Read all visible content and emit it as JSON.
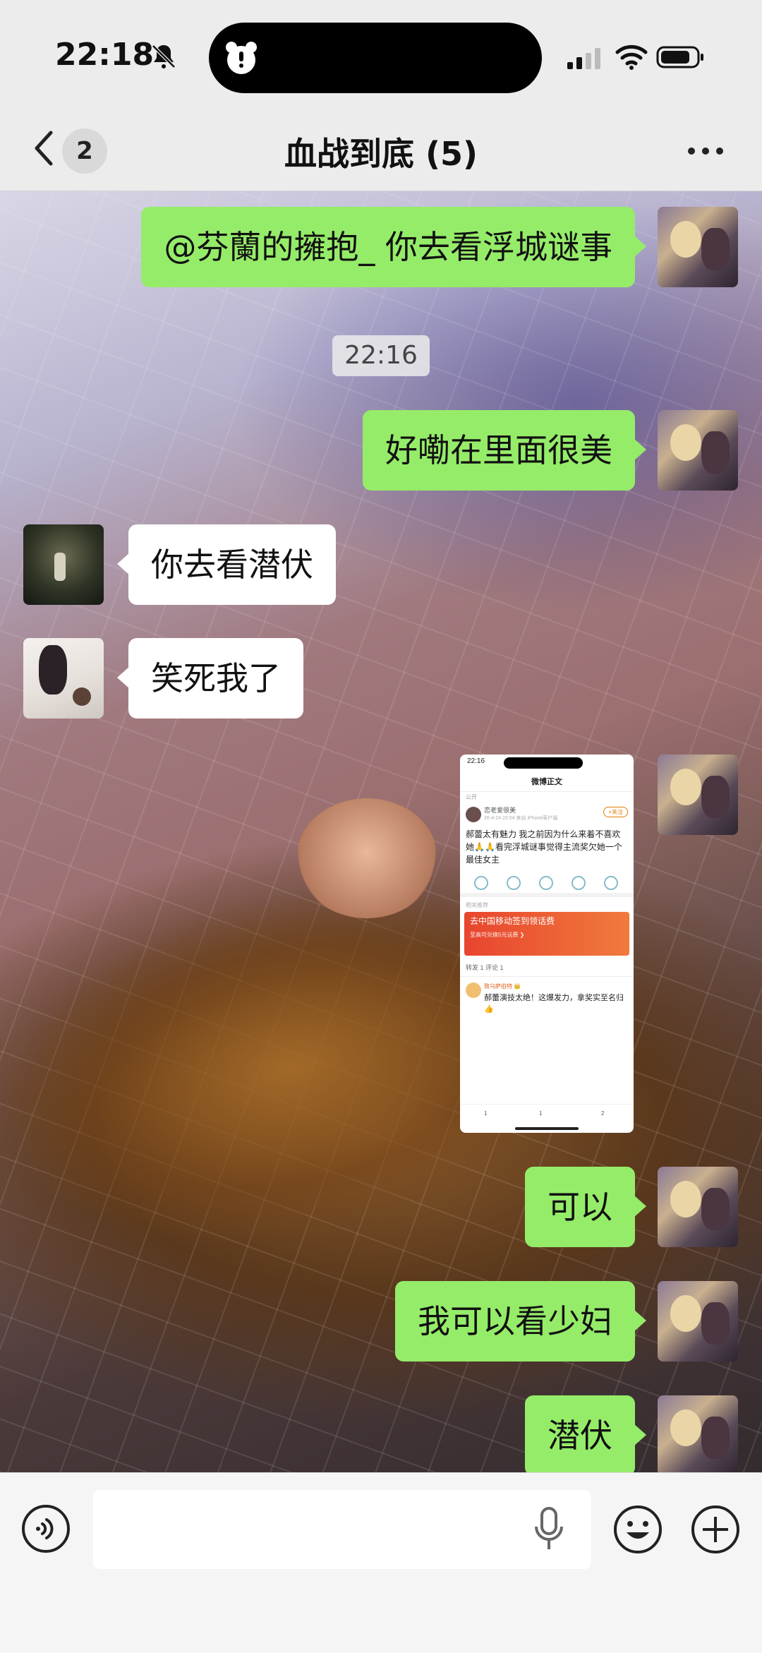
{
  "status_bar": {
    "time": "22:18"
  },
  "header": {
    "unread_count": "2",
    "title": "血战到底 (5)"
  },
  "messages": [
    {
      "side": "me",
      "text": "@芬蘭的擁抱_ 你去看浮城谜事"
    },
    {
      "type": "timestamp",
      "text": "22:16"
    },
    {
      "side": "me",
      "text": "好嘞在里面很美"
    },
    {
      "side": "other",
      "text": "你去看潜伏"
    },
    {
      "side": "other",
      "text": "笑死我了"
    },
    {
      "side": "me",
      "type": "image"
    },
    {
      "side": "me",
      "text": "可以"
    },
    {
      "side": "me",
      "text": "我可以看少妇"
    },
    {
      "side": "me",
      "text": "潜伏"
    }
  ],
  "screenshot_msg": {
    "time": "22:16",
    "header": "微博正文",
    "visibility": "公开",
    "username": "恋老爱很美",
    "meta": "26-4-24 22:04 来自 iPhone客户端",
    "follow": "+关注",
    "post": "郝蕾太有魅力 我之前因为什么来着不喜欢她🙏🙏看完浮城谜事觉得主流奖欠她一个最佳女主",
    "ad_label": "相关推荐",
    "ad_title": "去中国移动签到领话费",
    "ad_sub": "至高可兑换5元话费 ❯",
    "tabs": "转发 1  评论 1",
    "comment_name": "致乌萨伯特 👑",
    "comment": "郝蕾演技太绝！这爆发力，拿奖实至名归👍",
    "repost": "1",
    "comments": "1",
    "likes": "2"
  },
  "input_bar": {
    "placeholder": ""
  },
  "colors": {
    "my_bubble": "#95ec69",
    "other_bubble": "#ffffff"
  },
  "icons": [
    "bell-muted-icon",
    "wifi-icon",
    "battery-icon",
    "back-icon",
    "more-icon",
    "voice-icon",
    "mic-icon",
    "emoji-icon",
    "plus-icon"
  ]
}
